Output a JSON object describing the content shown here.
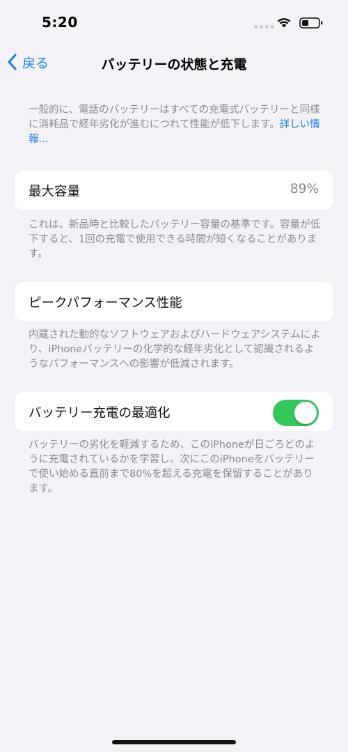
{
  "status_bar": {
    "time": "5:20"
  },
  "nav": {
    "back_label": "戻る",
    "title": "バッテリーの状態と充電"
  },
  "intro": {
    "text": "一般的に、電話のバッテリーはすべての充電式バッテリーと同様に消耗品で経年劣化が進むにつれて性能が低下します。",
    "link": "詳しい情報..."
  },
  "max_capacity": {
    "label": "最大容量",
    "value": "89%",
    "note": "これは、新品時と比較したバッテリー容量の基準です。容量が低下すると、1回の充電で使用できる時間が短くなることがあります。"
  },
  "peak_performance": {
    "label": "ピークパフォーマンス性能",
    "note": "内蔵された動的なソフトウェアおよびハードウェアシステムにより、iPhoneバッテリーの化学的な経年劣化として認識されるようなパフォーマンスへの影響が低減されます。"
  },
  "optimized_charging": {
    "label": "バッテリー充電の最適化",
    "enabled": true,
    "toggle_color": "#34c759",
    "note": "バッテリーの劣化を軽減するため、このiPhoneが日ごろどのように充電されているかを学習し、次にこのiPhoneをバッテリーで使い始める直前まで80%を超える充電を保留することがあります。"
  },
  "colors": {
    "accent": "#1a7bf2",
    "background": "#f2f2f7",
    "secondary_text": "#8a8a8e"
  },
  "icons": {
    "back": "chevron-left-icon",
    "wifi": "wifi-icon",
    "battery": "battery-icon",
    "signal": "signal-dots-icon"
  }
}
